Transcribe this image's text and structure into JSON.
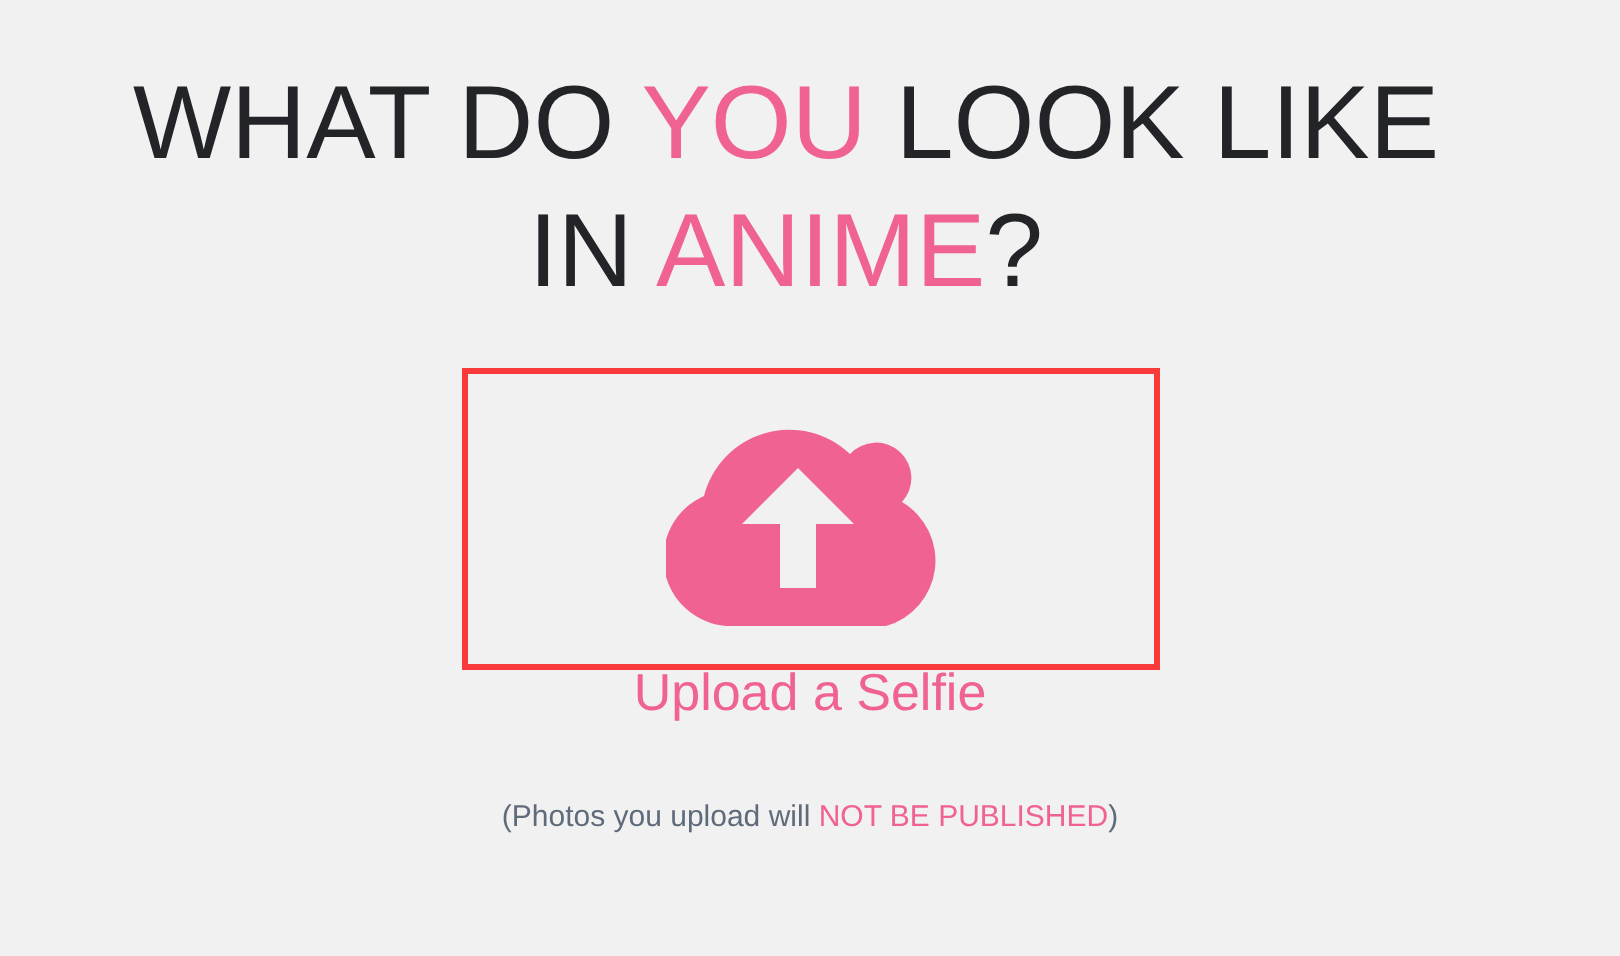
{
  "heading": {
    "lines": [
      [
        {
          "text": "WHAT DO ",
          "accent": false
        },
        {
          "text": "YOU",
          "accent": true
        },
        {
          "text": " LOOK LIKE",
          "accent": false
        }
      ],
      [
        {
          "text": "IN ",
          "accent": false
        },
        {
          "text": "ANIME",
          "accent": true
        },
        {
          "text": "?",
          "accent": false
        }
      ]
    ]
  },
  "upload": {
    "highlighted": true,
    "label": "Upload a Selfie"
  },
  "note": [
    {
      "text": "(Photos you upload will ",
      "accent": false
    },
    {
      "text": "NOT BE PUBLISHED",
      "accent": true
    },
    {
      "text": ")",
      "accent": false
    }
  ]
}
